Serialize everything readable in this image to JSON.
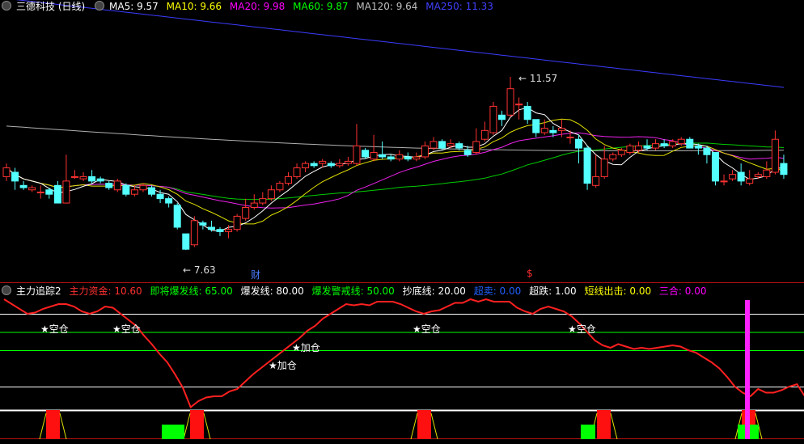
{
  "top_header": {
    "title": "三德科技 (日线)",
    "ma": [
      {
        "label": "MA5: 9.57",
        "color": "#ffffff"
      },
      {
        "label": "MA10: 9.66",
        "color": "#ffff00"
      },
      {
        "label": "MA20: 9.98",
        "color": "#ff00ff"
      },
      {
        "label": "MA60: 9.87",
        "color": "#00ff00"
      },
      {
        "label": "MA120: 9.64",
        "color": "#c0c0c0"
      },
      {
        "label": "MA250: 11.33",
        "color": "#4040ff"
      }
    ]
  },
  "bottom_header": {
    "title": "主力追踪2",
    "items": [
      {
        "label": "主力资金: 10.60",
        "color": "#ff3030"
      },
      {
        "label": "即将爆发线: 65.00",
        "color": "#00ff00"
      },
      {
        "label": "爆发线: 80.00",
        "color": "#ffffff"
      },
      {
        "label": "爆发警戒线: 50.00",
        "color": "#00ff00"
      },
      {
        "label": "抄底线: 20.00",
        "color": "#ffffff"
      },
      {
        "label": "超卖: 0.00",
        "color": "#2060ff"
      },
      {
        "label": "超跌: 1.00",
        "color": "#ffffff"
      },
      {
        "label": "短线出击: 0.00",
        "color": "#ffff00"
      },
      {
        "label": "三合: 0.00",
        "color": "#ff00ff"
      }
    ]
  },
  "price_labels": {
    "high": "11.57",
    "low": "7.63"
  },
  "event_markers": {
    "cai": "财",
    "s": "$"
  },
  "signals": {
    "kongcang": "★空仓",
    "jiacang": "★加仓"
  },
  "chart_data": [
    {
      "type": "candlestick",
      "title": "三德科技 (日线)",
      "extremes": {
        "high": 11.57,
        "low": 7.63
      },
      "candles": [
        [
          9.3,
          9.5,
          9.6,
          9.2
        ],
        [
          9.4,
          9.2,
          9.5,
          9.0
        ],
        [
          9.1,
          9.05,
          9.2,
          9.0
        ],
        [
          9.0,
          9.05,
          9.1,
          8.95
        ],
        [
          8.95,
          8.95,
          9.1,
          8.8
        ],
        [
          9.0,
          8.9,
          9.05,
          8.8
        ],
        [
          9.1,
          8.7,
          9.2,
          8.7
        ],
        [
          8.7,
          9.2,
          9.8,
          8.7
        ],
        [
          9.3,
          9.3,
          9.45,
          9.25
        ],
        [
          9.25,
          9.3,
          9.4,
          9.2
        ],
        [
          9.3,
          9.2,
          9.45,
          9.15
        ],
        [
          9.25,
          9.2,
          9.3,
          9.15
        ],
        [
          9.15,
          9.05,
          9.2,
          9.0
        ],
        [
          9.0,
          9.2,
          9.25,
          8.95
        ],
        [
          9.1,
          8.9,
          9.15,
          8.85
        ],
        [
          8.9,
          9.0,
          9.1,
          8.85
        ],
        [
          9.0,
          9.1,
          9.15,
          8.95
        ],
        [
          9.05,
          8.9,
          9.1,
          8.85
        ],
        [
          8.9,
          8.8,
          9.0,
          8.7
        ],
        [
          8.8,
          8.7,
          8.85,
          8.6
        ],
        [
          8.65,
          8.15,
          8.7,
          8.1
        ],
        [
          8.0,
          7.65,
          8.0,
          7.63
        ],
        [
          7.75,
          8.3,
          8.4,
          7.7
        ],
        [
          8.25,
          8.2,
          8.3,
          8.1
        ],
        [
          8.15,
          8.1,
          8.3,
          8.05
        ],
        [
          8.1,
          8.05,
          8.15,
          7.95
        ],
        [
          8.05,
          8.1,
          8.2,
          7.9
        ],
        [
          8.1,
          8.4,
          8.45,
          8.05
        ],
        [
          8.35,
          8.6,
          8.8,
          8.3
        ],
        [
          8.6,
          8.7,
          8.9,
          8.55
        ],
        [
          8.7,
          8.8,
          8.95,
          8.65
        ],
        [
          8.8,
          9.0,
          9.1,
          8.75
        ],
        [
          9.0,
          9.15,
          9.2,
          8.95
        ],
        [
          9.15,
          9.3,
          9.4,
          9.1
        ],
        [
          9.3,
          9.5,
          9.6,
          9.25
        ],
        [
          9.5,
          9.6,
          9.65,
          9.4
        ],
        [
          9.6,
          9.55,
          9.65,
          9.5
        ],
        [
          9.6,
          9.65,
          9.7,
          9.5
        ],
        [
          9.6,
          9.55,
          9.65,
          9.5
        ],
        [
          9.55,
          9.6,
          9.7,
          9.5
        ],
        [
          9.6,
          9.65,
          9.75,
          9.55
        ],
        [
          9.6,
          10.0,
          10.5,
          9.55
        ],
        [
          9.9,
          9.75,
          9.95,
          9.7
        ],
        [
          9.7,
          9.85,
          10.25,
          9.65
        ],
        [
          9.8,
          9.75,
          10.1,
          9.7
        ],
        [
          9.75,
          9.7,
          9.8,
          9.65
        ],
        [
          9.7,
          9.8,
          9.9,
          9.65
        ],
        [
          9.75,
          9.7,
          9.85,
          9.65
        ],
        [
          9.7,
          9.75,
          9.85,
          9.65
        ],
        [
          9.75,
          10.0,
          10.1,
          9.7
        ],
        [
          9.95,
          10.1,
          10.2,
          9.9
        ],
        [
          10.1,
          9.95,
          10.15,
          9.9
        ],
        [
          10.0,
          10.05,
          10.15,
          9.95
        ],
        [
          10.05,
          9.95,
          10.1,
          9.9
        ],
        [
          9.9,
          9.8,
          10.0,
          9.75
        ],
        [
          9.85,
          10.1,
          10.4,
          9.8
        ],
        [
          10.15,
          10.35,
          10.55,
          10.1
        ],
        [
          10.3,
          10.9,
          11.0,
          10.25
        ],
        [
          10.7,
          10.6,
          10.8,
          10.45
        ],
        [
          10.7,
          11.3,
          11.57,
          10.65
        ],
        [
          10.95,
          10.95,
          11.1,
          10.6
        ],
        [
          10.9,
          10.6,
          11.0,
          10.5
        ],
        [
          10.6,
          10.3,
          10.6,
          10.2
        ],
        [
          10.3,
          10.4,
          10.6,
          10.25
        ],
        [
          10.35,
          10.3,
          10.45,
          10.2
        ],
        [
          10.35,
          10.4,
          10.6,
          10.2
        ],
        [
          10.2,
          10.2,
          10.35,
          10.05
        ],
        [
          10.15,
          9.95,
          10.25,
          9.6
        ],
        [
          9.95,
          9.15,
          10.0,
          9.0
        ],
        [
          9.1,
          9.3,
          9.8,
          9.05
        ],
        [
          9.3,
          9.7,
          10.0,
          9.25
        ],
        [
          9.7,
          9.8,
          9.85,
          9.65
        ],
        [
          9.8,
          9.9,
          9.95,
          9.75
        ],
        [
          9.85,
          10.0,
          10.05,
          9.8
        ],
        [
          9.9,
          10.0,
          10.1,
          9.85
        ],
        [
          10.0,
          9.95,
          10.15,
          9.9
        ],
        [
          9.95,
          10.05,
          10.15,
          9.9
        ],
        [
          10.05,
          10.0,
          10.15,
          9.95
        ],
        [
          10.0,
          10.1,
          10.15,
          9.95
        ],
        [
          10.05,
          10.15,
          10.2,
          10.0
        ],
        [
          10.15,
          9.95,
          10.2,
          9.95
        ],
        [
          10.0,
          9.95,
          10.05,
          9.8
        ],
        [
          9.95,
          9.8,
          10.0,
          9.6
        ],
        [
          9.85,
          9.2,
          9.85,
          9.1
        ],
        [
          9.2,
          9.2,
          9.35,
          9.1
        ],
        [
          9.25,
          9.35,
          9.45,
          9.2
        ],
        [
          9.4,
          9.2,
          9.6,
          9.1
        ],
        [
          9.15,
          9.25,
          9.45,
          9.1
        ],
        [
          9.3,
          9.35,
          9.4,
          9.25
        ],
        [
          9.3,
          9.45,
          9.65,
          9.25
        ],
        [
          9.4,
          10.15,
          10.35,
          9.35
        ],
        [
          9.6,
          9.35,
          9.8,
          9.25
        ]
      ]
    },
    {
      "type": "line",
      "title": "主力追踪2",
      "ylim": [
        0,
        100
      ],
      "series": [
        {
          "name": "主力资金",
          "color": "#ff2020",
          "values": [
            92,
            88,
            84,
            80,
            81,
            84,
            86,
            88,
            88,
            86,
            82,
            80,
            82,
            86,
            85,
            80,
            75,
            70,
            62,
            55,
            47,
            40,
            30,
            19,
            3,
            8,
            11,
            12,
            12,
            16,
            18,
            24,
            30,
            35,
            40,
            45,
            50,
            55,
            60,
            66,
            70,
            76,
            80,
            84,
            88,
            87,
            88,
            87,
            90,
            90,
            90,
            88,
            85,
            82,
            80,
            82,
            83,
            86,
            89,
            89,
            92,
            90,
            92,
            90,
            90,
            90,
            85,
            82,
            80,
            84,
            86,
            84,
            82,
            78,
            72,
            65,
            58,
            54,
            52,
            55,
            53,
            51,
            52,
            51,
            52,
            53,
            54,
            53,
            50,
            48,
            44,
            40,
            35,
            28,
            20,
            15,
            12,
            18,
            15,
            15,
            17,
            20,
            22,
            12
          ]
        }
      ],
      "reference_lines": [
        {
          "name": "爆发线",
          "value": 80,
          "color": "#ffffff"
        },
        {
          "name": "即将爆发线",
          "value": 65,
          "color": "#00ff00"
        },
        {
          "name": "爆发警戒线",
          "value": 50,
          "color": "#00ff00"
        },
        {
          "name": "抄底线",
          "value": 20,
          "color": "#ffffff"
        }
      ],
      "current": {
        "主力资金": 10.6,
        "即将爆发线": 65,
        "爆发线": 80,
        "爆发警戒线": 50,
        "抄底线": 20,
        "超卖": 0,
        "超跌": 1,
        "短线出击": 0,
        "三合": 0
      }
    }
  ]
}
